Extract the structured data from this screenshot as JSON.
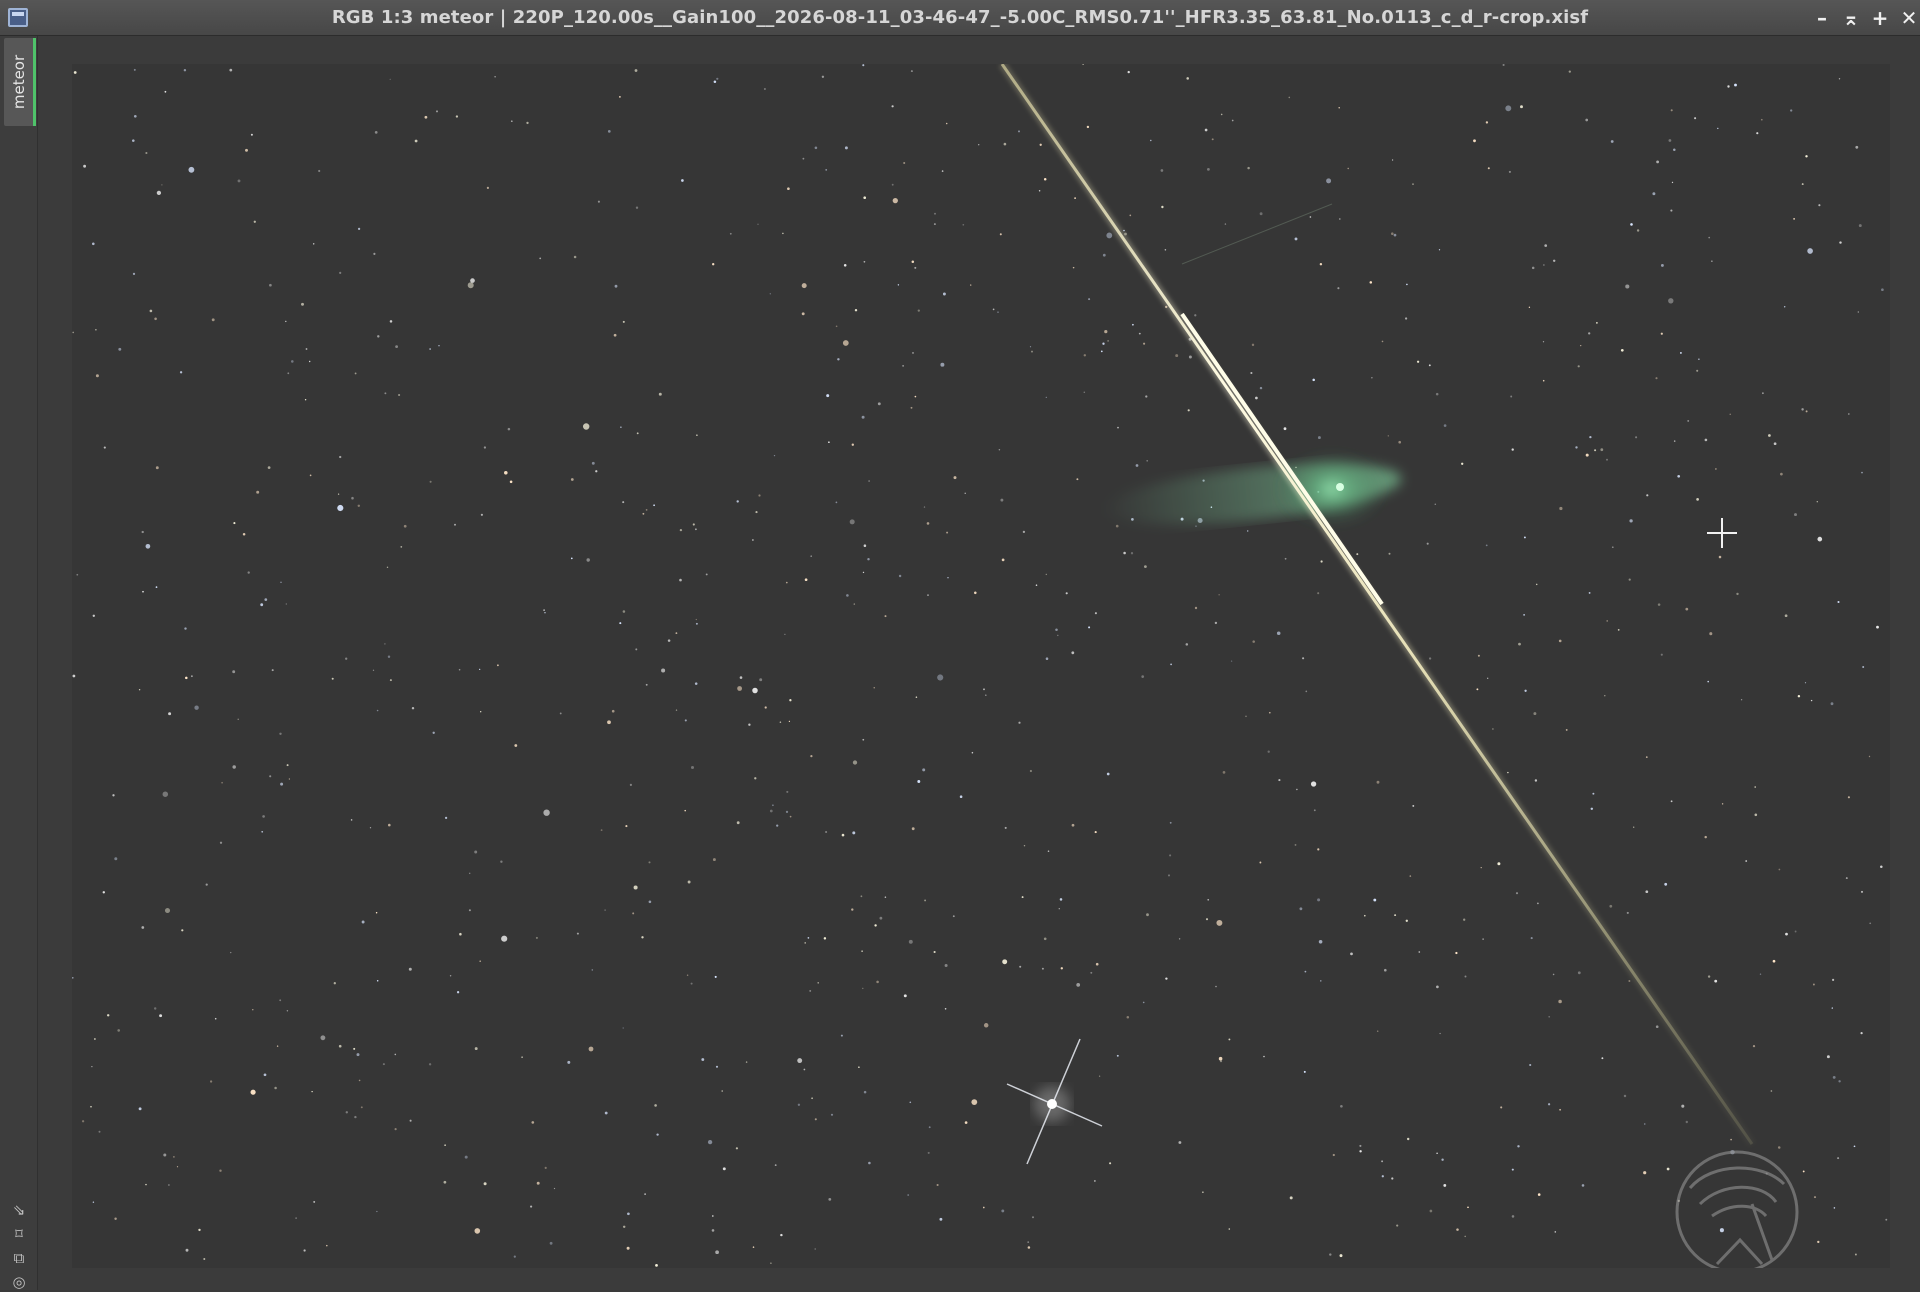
{
  "window": {
    "title": "RGB 1:3 meteor | 220P_120.00s__Gain100__2026-08-11_03-46-47_-5.00C_RMS0.71''_HFR3.35_63.81_No.0113_c_d_r-crop.xisf",
    "controls": {
      "minimize": "–",
      "shade": "⌅",
      "maximize": "+",
      "close": "✕"
    }
  },
  "sidebar": {
    "view_tab_label": "meteor",
    "tools": [
      {
        "name": "zoom-fit-icon",
        "glyph": "⇘"
      },
      {
        "name": "move-icon",
        "glyph": "⌑"
      },
      {
        "name": "clone-icon",
        "glyph": "⧉"
      },
      {
        "name": "target-icon",
        "glyph": "◎"
      }
    ]
  },
  "image": {
    "background_color": "#363636",
    "meteor_color": "#f6f0c6",
    "comet_color": "#7fe0a5",
    "bright_star_color": "#ffffff",
    "watermark": "observatory-logo"
  }
}
